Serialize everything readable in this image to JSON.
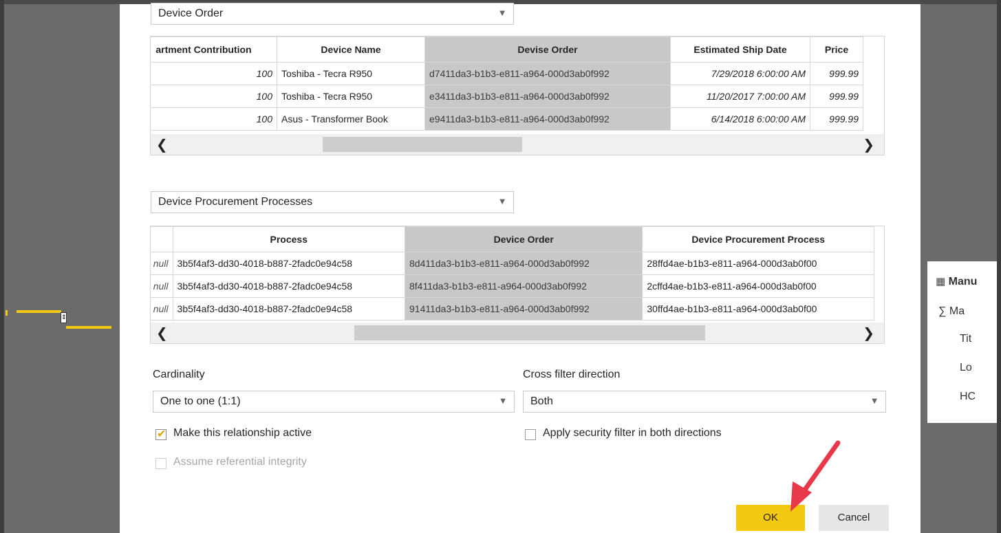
{
  "top_table_selector": {
    "value": "Device Order"
  },
  "top_table": {
    "columns": [
      "artment Contribution",
      "Device Name",
      "Devise Order",
      "Estimated Ship Date",
      "Price"
    ],
    "rows": [
      [
        "100",
        "Toshiba - Tecra R950",
        "d7411da3-b1b3-e811-a964-000d3ab0f992",
        "7/29/2018 6:00:00 AM",
        "999.99"
      ],
      [
        "100",
        "Toshiba - Tecra R950",
        "e3411da3-b1b3-e811-a964-000d3ab0f992",
        "11/20/2017 7:00:00 AM",
        "999.99"
      ],
      [
        "100",
        "Asus - Transformer Book",
        "e9411da3-b1b3-e811-a964-000d3ab0f992",
        "6/14/2018 6:00:00 AM",
        "999.99"
      ]
    ],
    "selected_column": 2
  },
  "bottom_table_selector": {
    "value": "Device Procurement Processes"
  },
  "bottom_table": {
    "columns": [
      "",
      "Process",
      "Device Order",
      "Device Procurement Process"
    ],
    "rows": [
      [
        "null",
        "3b5f4af3-dd30-4018-b887-2fadc0e94c58",
        "8d411da3-b1b3-e811-a964-000d3ab0f992",
        "28ffd4ae-b1b3-e811-a964-000d3ab0f00"
      ],
      [
        "null",
        "3b5f4af3-dd30-4018-b887-2fadc0e94c58",
        "8f411da3-b1b3-e811-a964-000d3ab0f992",
        "2cffd4ae-b1b3-e811-a964-000d3ab0f00"
      ],
      [
        "null",
        "3b5f4af3-dd30-4018-b887-2fadc0e94c58",
        "91411da3-b1b3-e811-a964-000d3ab0f992",
        "30ffd4ae-b1b3-e811-a964-000d3ab0f00"
      ]
    ],
    "selected_column": 2
  },
  "cardinality": {
    "label": "Cardinality",
    "value": "One to one (1:1)"
  },
  "cross_filter": {
    "label": "Cross filter direction",
    "value": "Both"
  },
  "options": {
    "active": {
      "label": "Make this relationship active",
      "checked": true
    },
    "referential": {
      "label": "Assume referential integrity",
      "checked": false,
      "disabled": true
    },
    "security": {
      "label": "Apply security filter in both directions",
      "checked": false
    }
  },
  "buttons": {
    "ok": "OK",
    "cancel": "Cancel"
  },
  "background_table": {
    "title": "Manu",
    "sigma": "∑",
    "fields": [
      "Ma",
      "Tit",
      "Lo",
      "HC"
    ]
  },
  "colors": {
    "accent": "#f2c811",
    "arrow": "#e8394a",
    "selected_column": "#c8c8c8"
  }
}
